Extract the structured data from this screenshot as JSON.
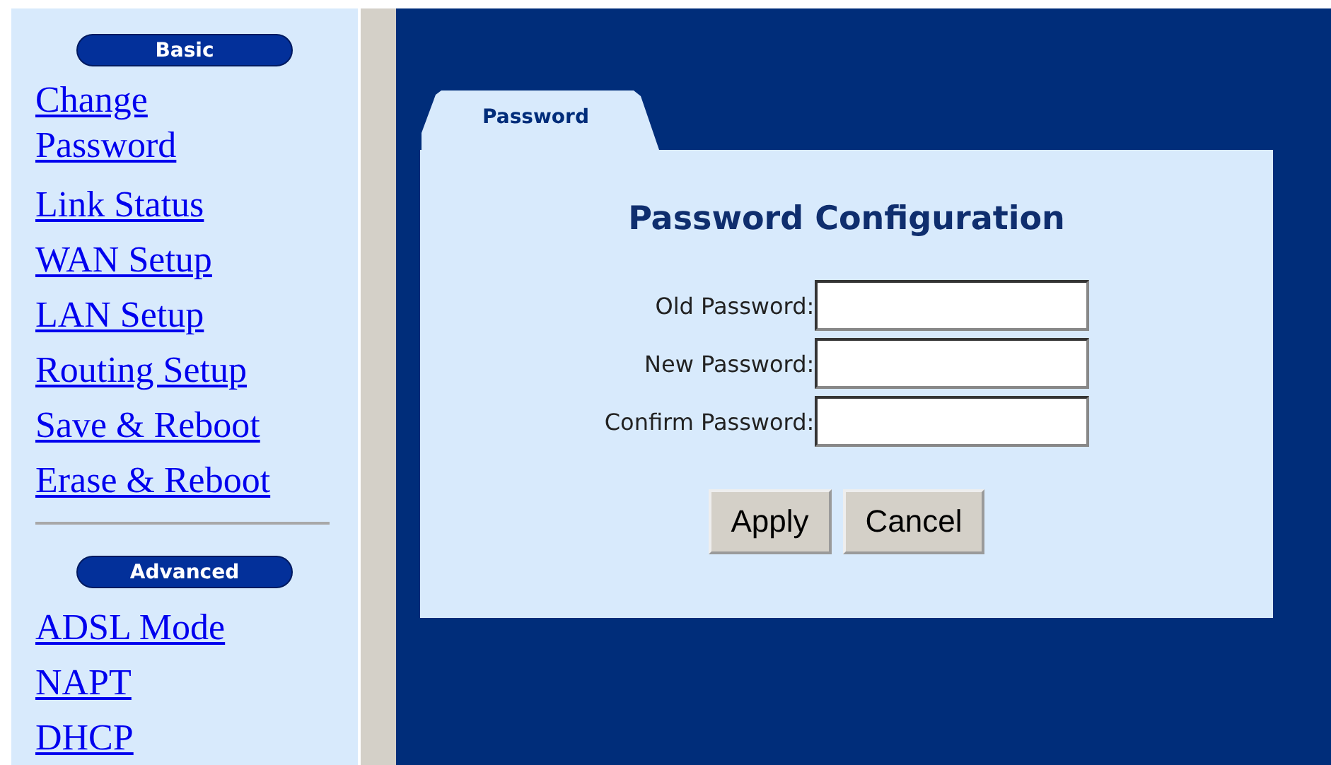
{
  "sidebar": {
    "sections": [
      {
        "heading": "Basic",
        "links": [
          "Change Password",
          "Link Status",
          "WAN Setup",
          "LAN Setup",
          "Routing Setup",
          "Save & Reboot",
          "Erase & Reboot"
        ]
      },
      {
        "heading": "Advanced",
        "links": [
          "ADSL Mode",
          "NAPT",
          "DHCP"
        ]
      }
    ]
  },
  "tab": {
    "label": "Password"
  },
  "panel": {
    "title": "Password Configuration",
    "fields": [
      {
        "label": "Old Password:"
      },
      {
        "label": "New Password:"
      },
      {
        "label": "Confirm Password:"
      }
    ],
    "buttons": [
      "Apply",
      "Cancel"
    ]
  }
}
